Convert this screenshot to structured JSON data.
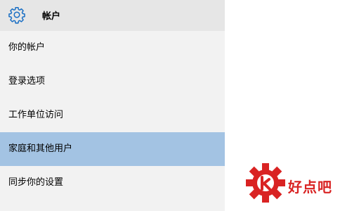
{
  "header": {
    "title": "帐户",
    "icon": "gear-icon",
    "accent_color": "#1a6fc4"
  },
  "nav": {
    "items": [
      {
        "label": "你的帐户",
        "selected": false
      },
      {
        "label": "登录选项",
        "selected": false
      },
      {
        "label": "工作单位访问",
        "selected": false
      },
      {
        "label": "家庭和其他用户",
        "selected": true
      },
      {
        "label": "同步你的设置",
        "selected": false
      }
    ],
    "selected_color": "#a3c3e3"
  },
  "watermark": {
    "text": "好点吧",
    "color": "#d92323"
  }
}
